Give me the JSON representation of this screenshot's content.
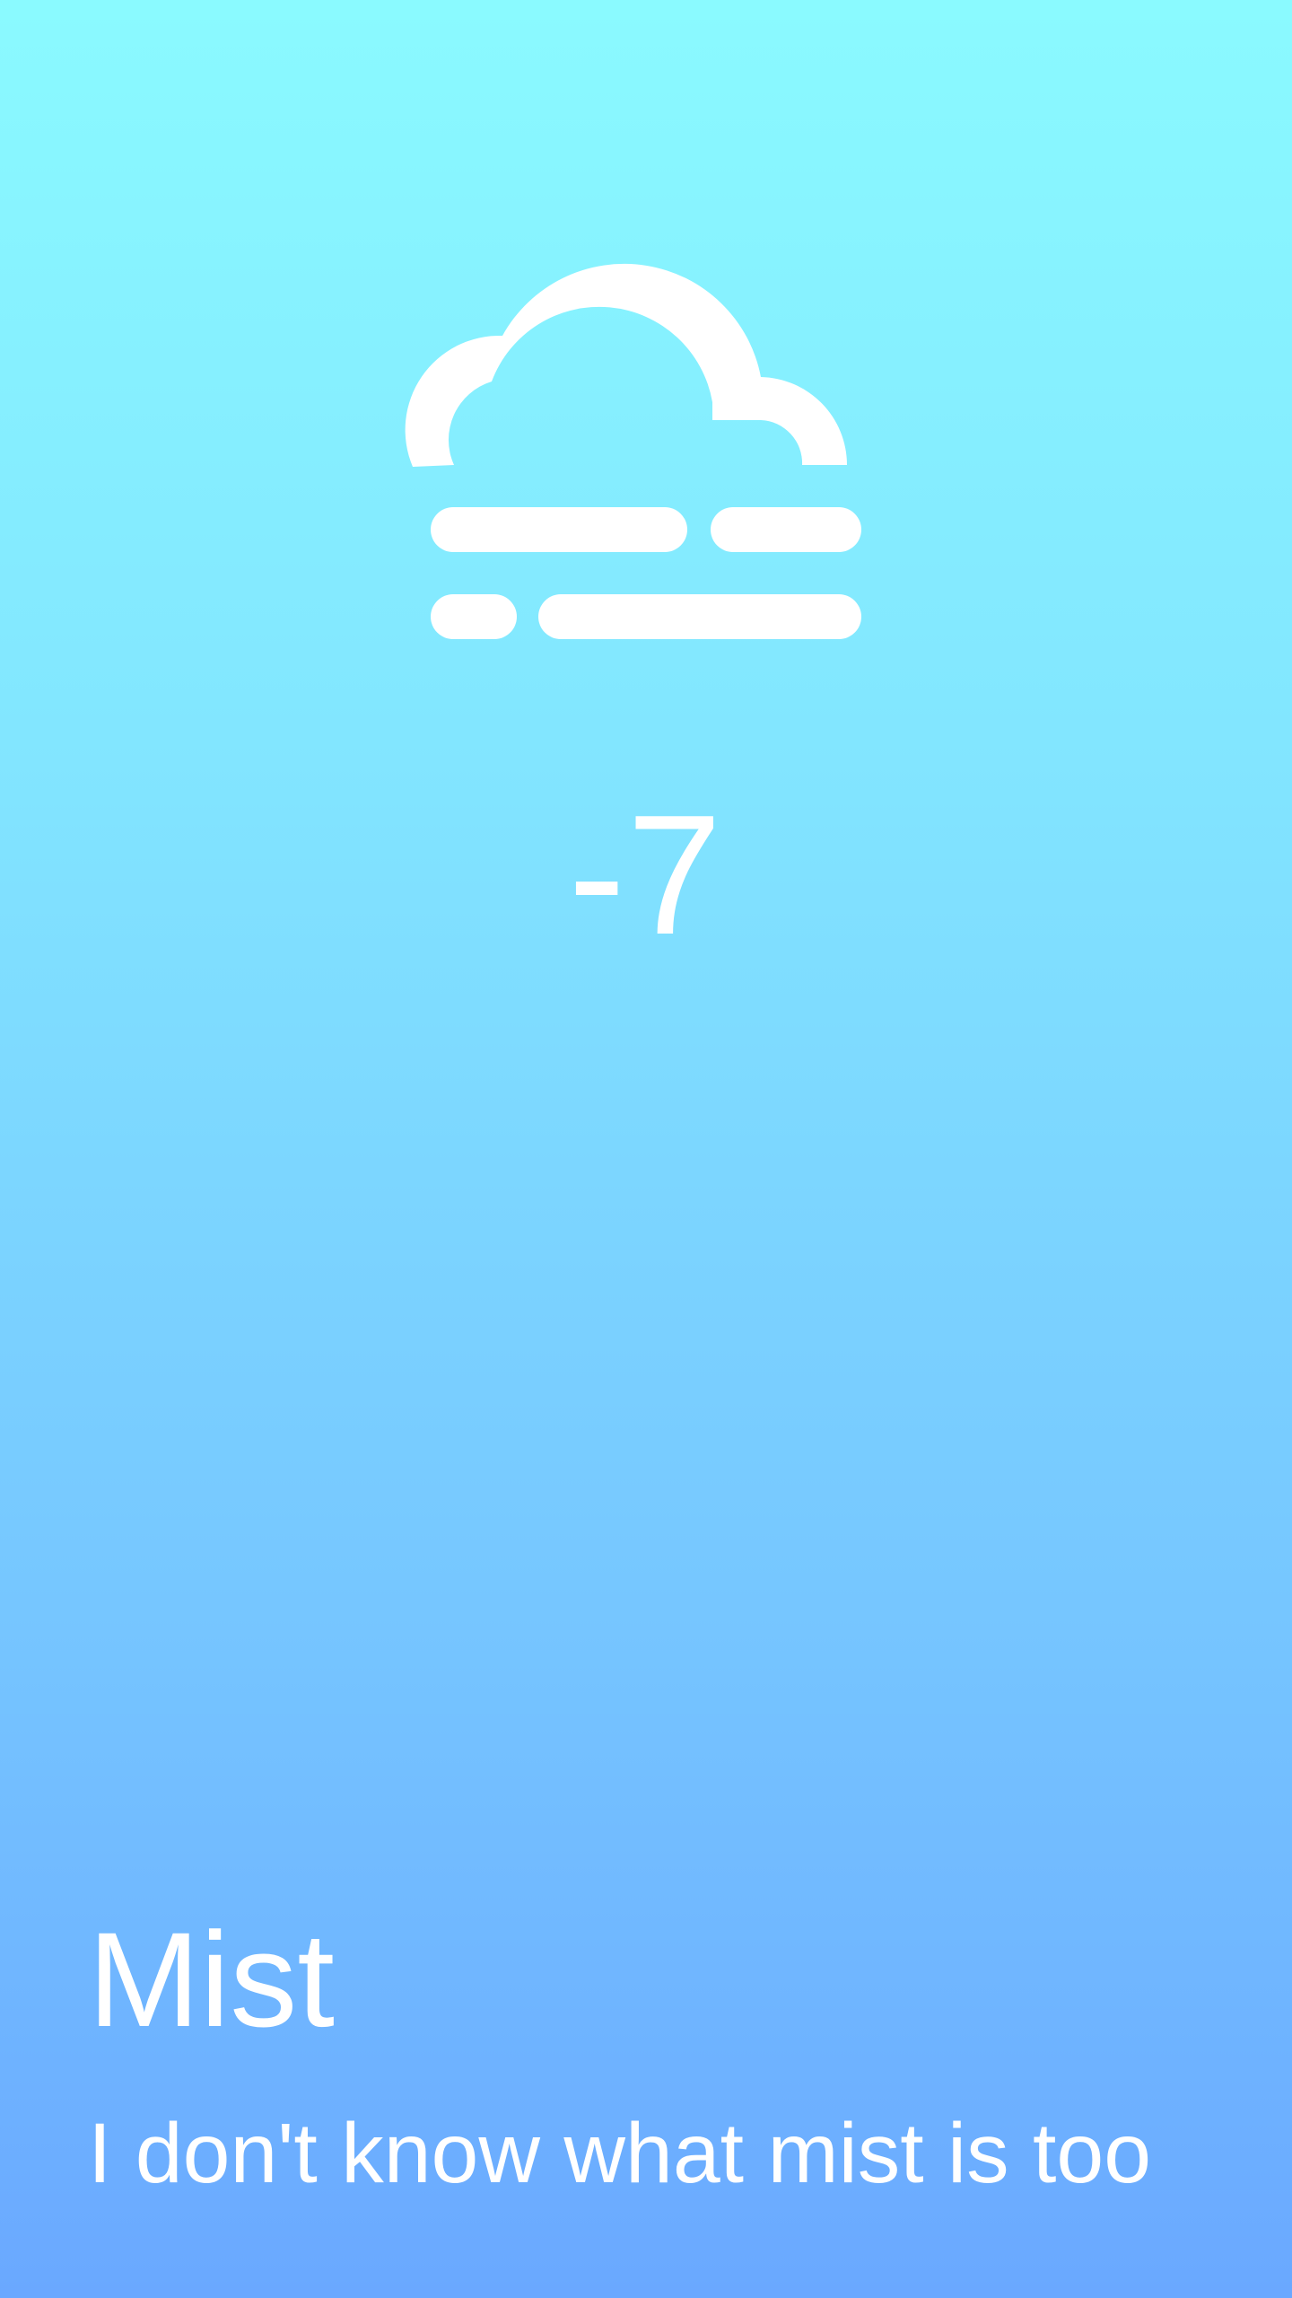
{
  "weather": {
    "icon": "mist-icon",
    "temperature": "-7",
    "condition": "Mist",
    "description": "I don't know what mist is too"
  },
  "colors": {
    "background_top": "#8afaff",
    "background_bottom": "#6aa8ff",
    "foreground": "#ffffff"
  }
}
